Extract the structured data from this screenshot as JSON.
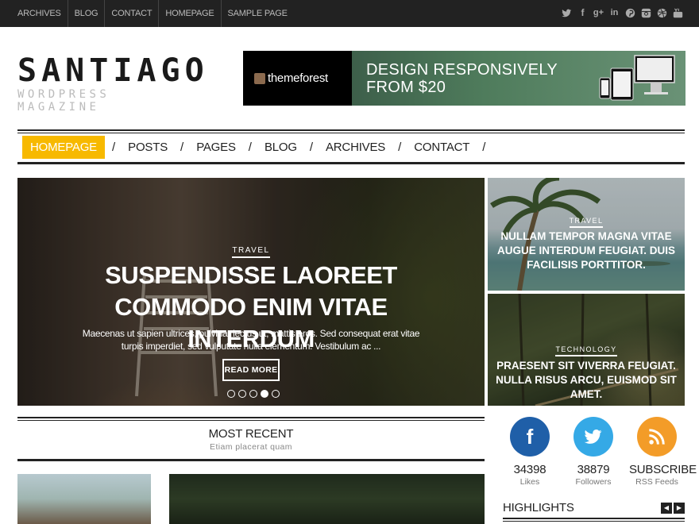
{
  "topbar": {
    "links": [
      "ARCHIVES",
      "BLOG",
      "CONTACT",
      "HOMEPAGE",
      "SAMPLE PAGE"
    ],
    "social_icons": [
      "twitter-icon",
      "facebook-icon",
      "google-plus-icon",
      "linkedin-icon",
      "pinterest-icon",
      "instagram-icon",
      "dribbble-icon",
      "youtube-icon"
    ]
  },
  "logo": {
    "title": "SANTIAGO",
    "subtitle": "WORDPRESS MAGAZINE"
  },
  "banner": {
    "brand": "themeforest",
    "line1": "DESIGN RESPONSIVELY",
    "line2": "FROM $20"
  },
  "nav": {
    "items": [
      "HOMEPAGE",
      "POSTS",
      "PAGES",
      "BLOG",
      "ARCHIVES",
      "CONTACT"
    ],
    "active_index": 0,
    "accent": "#f7b900"
  },
  "hero": {
    "category": "TRAVEL",
    "title": "SUSPENDISSE LAOREET COMMODO ENIM VITAE INTERDUM",
    "excerpt": "Maecenas ut sapien ultrices, pulvinar lectus ut, mattis eros. Sed consequat erat vitae turpis imperdiet, sed vulputate nulla elementum. Vestibulum ac ...",
    "button": "READ MORE",
    "slides": 5,
    "active_slide": 3
  },
  "cards": [
    {
      "category": "TRAVEL",
      "title": "NULLAM TEMPOR MAGNA VITAE AUGUE INTERDUM FEUGIAT. DUIS FACILISIS PORTTITOR."
    },
    {
      "category": "TECHNOLOGY",
      "title": "PRAESENT SIT VIVERRA FEUGIAT. NULLA RISUS ARCU, EUISMOD SIT AMET."
    }
  ],
  "most_recent": {
    "title": "MOST RECENT",
    "subtitle": "Etiam placerat quam"
  },
  "social": {
    "facebook": {
      "count": "34398",
      "label": "Likes",
      "color": "#1f5fa8"
    },
    "twitter": {
      "count": "38879",
      "label": "Followers",
      "color": "#35a9e6"
    },
    "rss": {
      "count": "SUBSCRIBE",
      "label": "RSS Feeds",
      "color": "#f39c28"
    }
  },
  "highlights": {
    "title": "HIGHLIGHTS"
  }
}
